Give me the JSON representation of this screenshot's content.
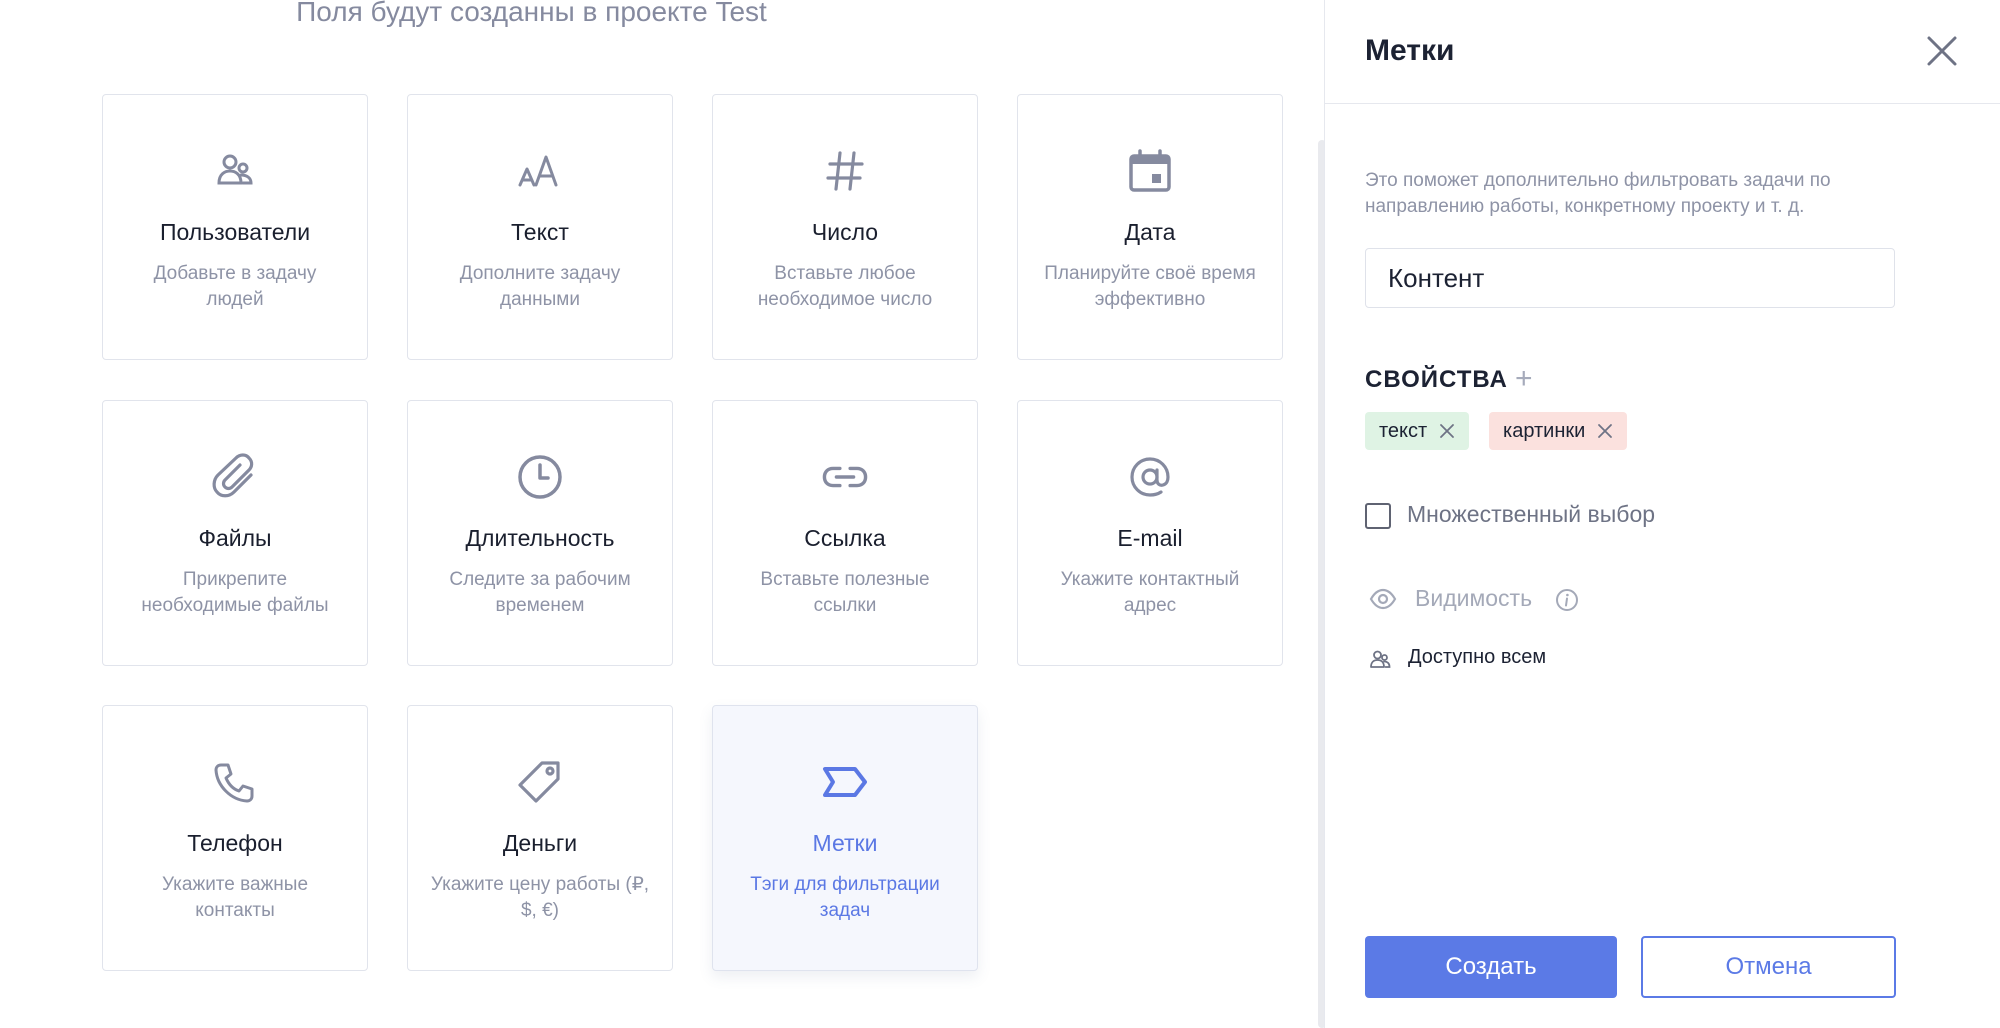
{
  "main": {
    "subtitle": "Поля будут созданны в проекте Test",
    "field_types": [
      {
        "icon": "users-icon",
        "title": "Пользователи",
        "desc": "Добавьте в задачу людей"
      },
      {
        "icon": "text-icon",
        "title": "Текст",
        "desc": "Дополните задачу данными"
      },
      {
        "icon": "hash-icon",
        "title": "Число",
        "desc": "Вставьте любое необходимое число"
      },
      {
        "icon": "calendar-icon",
        "title": "Дата",
        "desc": "Планируйте своё время эффективно"
      },
      {
        "icon": "paperclip-icon",
        "title": "Файлы",
        "desc": "Прикрепите необходимые файлы"
      },
      {
        "icon": "clock-icon",
        "title": "Длительность",
        "desc": "Следите за рабочим временем"
      },
      {
        "icon": "link-icon",
        "title": "Ссылка",
        "desc": "Вставьте полезные ссылки"
      },
      {
        "icon": "at-icon",
        "title": "E-mail",
        "desc": "Укажите контактный адрес"
      },
      {
        "icon": "phone-icon",
        "title": "Телефон",
        "desc": "Укажите важные контакты"
      },
      {
        "icon": "price-tag-icon",
        "title": "Деньги",
        "desc": "Укажите цену работы (₽, $, €)"
      },
      {
        "icon": "label-tag-icon",
        "title": "Метки",
        "desc": "Тэги для фильтрации задач",
        "selected": true
      }
    ]
  },
  "panel": {
    "title": "Метки",
    "hint": "Это поможет дополнительно фильтровать задачи по направлению работы, конкретному проекту и т. д.",
    "name_value": "Контент",
    "properties_label": "СВОЙСТВА",
    "properties_add": "+",
    "tags": [
      {
        "label": "текст",
        "color": "#dff3e4"
      },
      {
        "label": "картинки",
        "color": "#fbe1de"
      }
    ],
    "multiple_choice_label": "Множественный выбор",
    "visibility_label": "Видимость",
    "access_label": "Доступно всем",
    "create_label": "Создать",
    "cancel_label": "Отмена"
  },
  "colors": {
    "accent": "#5b7ae6",
    "icon_gray": "#858a9f",
    "tag_green": "#dff3e4",
    "tag_red": "#fbe1de"
  }
}
